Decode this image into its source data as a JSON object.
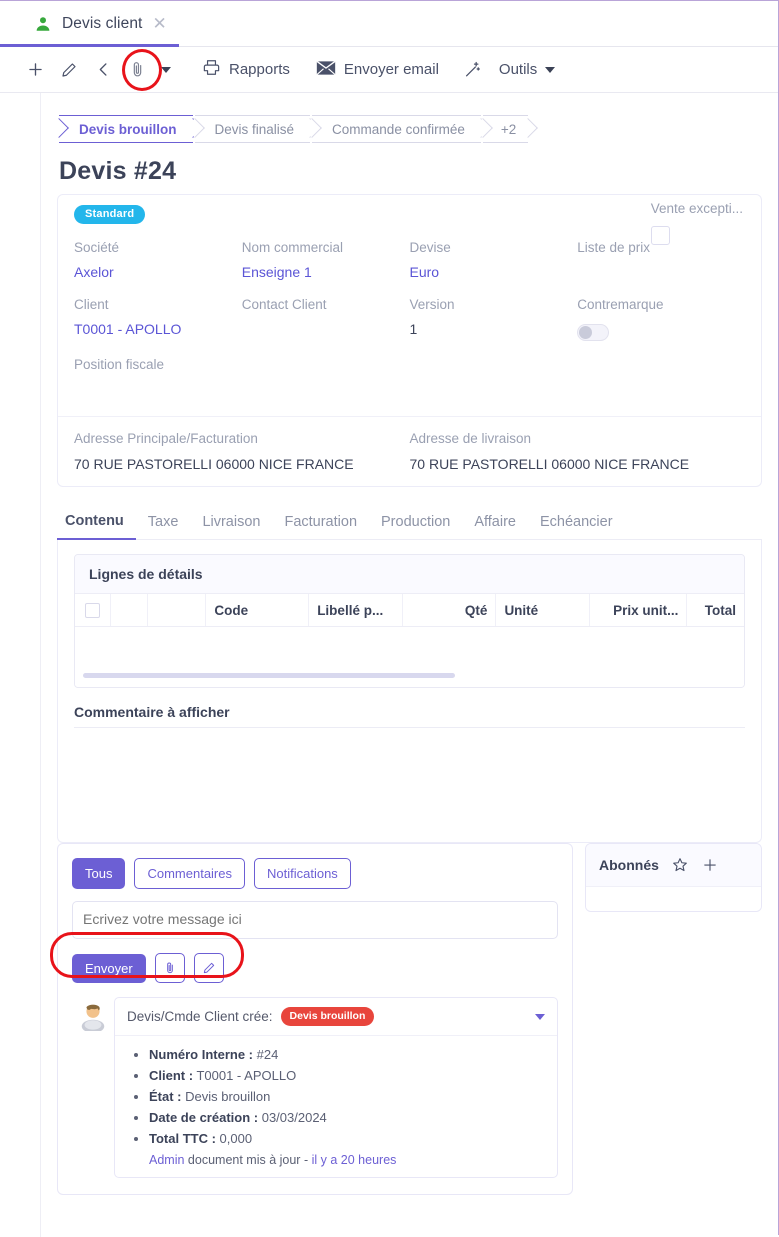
{
  "window": {
    "tab_title": "Devis client",
    "tab_icon": "person-icon",
    "close_icon": "close-icon"
  },
  "toolbar": {
    "new_icon": "plus-icon",
    "edit_icon": "pencil-icon",
    "back_icon": "arrow-left-icon",
    "attach_icon": "paperclip-icon",
    "dropdown_icon": "chevron-down-icon",
    "reports_label": "Rapports",
    "reports_icon": "printer-icon",
    "email_label": "Envoyer email",
    "email_icon": "envelope-icon",
    "wand_icon": "magic-wand-icon",
    "tools_label": "Outils",
    "tools_caret_icon": "chevron-down-icon"
  },
  "status_steps": [
    {
      "label": "Devis brouillon",
      "active": true
    },
    {
      "label": "Devis finalisé",
      "active": false
    },
    {
      "label": "Commande confirmée",
      "active": false
    },
    {
      "label": "+2",
      "active": false
    }
  ],
  "document": {
    "title": "Devis #24",
    "badge": "Standard",
    "badge_color": "#23b6eb"
  },
  "header_fields": {
    "vente_exceptionnelle_label": "Vente excepti...",
    "row1": [
      {
        "label": "Société",
        "value": "Axelor",
        "link": true
      },
      {
        "label": "Nom commercial",
        "value": "Enseigne 1",
        "link": true
      },
      {
        "label": "Devise",
        "value": "Euro",
        "link": true
      },
      {
        "label": "Liste de prix",
        "value": "",
        "link": false
      }
    ],
    "row2": [
      {
        "label": "Client",
        "value": "T0001 - APOLLO",
        "link": true
      },
      {
        "label": "Contact Client",
        "value": "",
        "link": false
      },
      {
        "label": "Version",
        "value": "1",
        "link": false
      },
      {
        "label": "Contremarque",
        "value": "",
        "link": false
      }
    ],
    "row3": [
      {
        "label": "Position fiscale",
        "value": "",
        "link": false
      }
    ],
    "addresses": [
      {
        "label": "Adresse Principale/Facturation",
        "value": "70 RUE PASTORELLI 06000 NICE FRANCE"
      },
      {
        "label": "Adresse de livraison",
        "value": "70 RUE PASTORELLI 06000 NICE FRANCE"
      }
    ]
  },
  "tabs": [
    {
      "label": "Contenu",
      "selected": true
    },
    {
      "label": "Taxe",
      "selected": false
    },
    {
      "label": "Livraison",
      "selected": false
    },
    {
      "label": "Facturation",
      "selected": false
    },
    {
      "label": "Production",
      "selected": false
    },
    {
      "label": "Affaire",
      "selected": false
    },
    {
      "label": "Echéancier",
      "selected": false
    }
  ],
  "grid": {
    "title": "Lignes de détails",
    "columns": [
      "",
      "",
      "",
      "Code",
      "Libellé p...",
      "Qté",
      "Unité",
      "Prix unit...",
      "Total"
    ],
    "rows": []
  },
  "comment_section": {
    "label": "Commentaire à afficher",
    "value": ""
  },
  "messages": {
    "filters": [
      {
        "label": "Tous",
        "active": true
      },
      {
        "label": "Commentaires",
        "active": false
      },
      {
        "label": "Notifications",
        "active": false
      }
    ],
    "input_placeholder": "Ecrivez votre message ici",
    "input_value": "",
    "send_label": "Envoyer",
    "attach_icon": "paperclip-icon",
    "edit_icon": "pencil-icon",
    "thread": [
      {
        "avatar_icon": "user-avatar",
        "title": "Devis/Cmde Client crée:",
        "status_pill": "Devis brouillon",
        "status_pill_color": "#e8453c",
        "caret_icon": "chevron-down-icon",
        "details": [
          {
            "label": "Numéro Interne :",
            "value": "#24"
          },
          {
            "label": "Client :",
            "value": "T0001 - APOLLO"
          },
          {
            "label": "État :",
            "value": "Devis brouillon"
          },
          {
            "label": "Date de création :",
            "value": "03/03/2024"
          },
          {
            "label": "Total TTC :",
            "value": "0,000"
          }
        ],
        "author": "Admin",
        "action": "document mis à jour",
        "separator": "-",
        "time": "il y a 20 heures"
      }
    ]
  },
  "subscribers": {
    "title": "Abonnés",
    "star_icon": "star-icon",
    "add_icon": "plus-icon"
  },
  "annotations": {
    "ring_color": "#e8131a",
    "targets": [
      "paperclip-icon",
      "message-input"
    ]
  },
  "theme": {
    "accent": "#6c5fd4",
    "text": "#3c4359",
    "muted": "#9aa0b2",
    "link": "#5b55d6"
  }
}
